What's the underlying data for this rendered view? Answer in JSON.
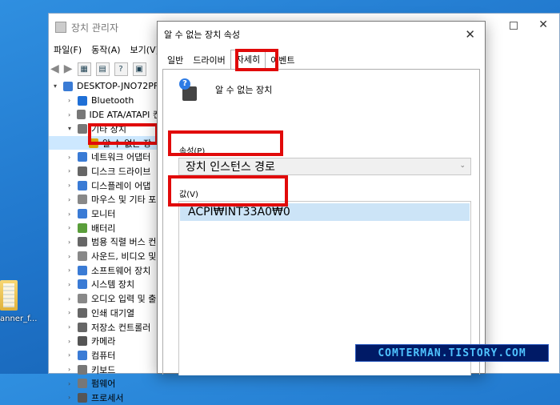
{
  "desktop": {
    "icon_label": "anner_f..."
  },
  "device_manager": {
    "title": "장치 관리자",
    "menu": [
      "파일(F)",
      "동작(A)",
      "보기(V)"
    ],
    "tree": {
      "root": "DESKTOP-JNO72PF",
      "items": [
        {
          "label": "Bluetooth",
          "color": "#1f6fd6"
        },
        {
          "label": "IDE ATA/ATAPI 컨",
          "color": "#777777"
        },
        {
          "label": "기타 장치",
          "color": "#777777",
          "expanded": true
        },
        {
          "label": "알 수 없는 장",
          "color": "#d9a400",
          "sub": true,
          "selected": true
        },
        {
          "label": "네트워크 어댑터",
          "color": "#3a7bd5"
        },
        {
          "label": "디스크 드라이브",
          "color": "#666666"
        },
        {
          "label": "디스플레이 어댑",
          "color": "#3a7bd5"
        },
        {
          "label": "마우스 및 기타 포",
          "color": "#888888"
        },
        {
          "label": "모니터",
          "color": "#3a7bd5"
        },
        {
          "label": "배터리",
          "color": "#5a9e3a"
        },
        {
          "label": "범용 직렬 버스 컨",
          "color": "#666666"
        },
        {
          "label": "사운드, 비디오 및",
          "color": "#888888"
        },
        {
          "label": "소프트웨어 장치",
          "color": "#3a7bd5"
        },
        {
          "label": "시스템 장치",
          "color": "#3a7bd5"
        },
        {
          "label": "오디오 입력 및 출",
          "color": "#888888"
        },
        {
          "label": "인쇄 대기열",
          "color": "#666666"
        },
        {
          "label": "저장소 컨트롤러",
          "color": "#666666"
        },
        {
          "label": "카메라",
          "color": "#555555"
        },
        {
          "label": "컴퓨터",
          "color": "#3a7bd5"
        },
        {
          "label": "키보드",
          "color": "#777777"
        },
        {
          "label": "펌웨어",
          "color": "#777777"
        },
        {
          "label": "프로세서",
          "color": "#555555"
        }
      ]
    }
  },
  "dialog": {
    "title": "알 수 없는 장치 속성",
    "tabs": [
      "일반",
      "드라이버",
      "자세히",
      "이벤트"
    ],
    "active_tab": "자세히",
    "device_name": "알 수 없는 장치",
    "property_label": "속성(P)",
    "property_value": "장치 인스턴스 경로",
    "value_label": "값(V)",
    "value": "ACPI₩INT33A0₩0"
  },
  "watermark": "COMTERMAN.TISTORY.COM",
  "colors": {
    "highlight": "#e10a0a",
    "selection": "#cce4f7",
    "desktop": "#1e73c9"
  }
}
